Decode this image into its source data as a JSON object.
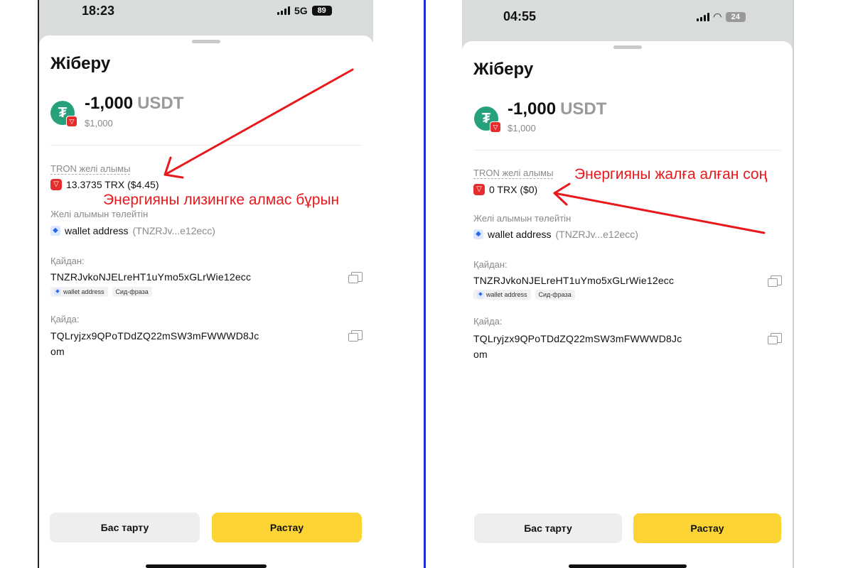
{
  "colors": {
    "accent": "#fcd535",
    "annotation": "#e8191d",
    "divider": "#1f2bd6",
    "usdt": "#26a17b",
    "tron": "#e52d2d"
  },
  "left": {
    "status": {
      "time": "18:23",
      "network": "5G",
      "battery": "89"
    },
    "title": "Жіберу",
    "amount": "-1,000",
    "unit": "USDT",
    "fiat": "$1,000",
    "fee_label": "TRON желі алымы",
    "fee_value": "13.3735 TRX ($4.45)",
    "payer_label": "Желі алымын төлейтін",
    "payer_name": "wallet address",
    "payer_short": "(TNZRJv...e12ecc)",
    "from_label": "Қайдан:",
    "from_address": "TNZRJvkoNJELreHT1uYmo5xGLrWie12ecc",
    "tag_wallet": "wallet address",
    "tag_seed": "Сид-фраза",
    "to_label": "Қайда:",
    "to_address_line1": "TQLryjzx9QPoTDdZQ22mSW3mFWWWD8Jc",
    "to_address_line2": "om",
    "cancel": "Бас тарту",
    "confirm": "Растау",
    "annotation": "Энергияны лизингке алмас бұрын"
  },
  "right": {
    "status": {
      "time": "04:55",
      "battery": "24"
    },
    "title": "Жіберу",
    "amount": "-1,000",
    "unit": "USDT",
    "fiat": "$1,000",
    "fee_label": "TRON желі алымы",
    "fee_value": "0 TRX ($0)",
    "payer_label": "Желі алымын төлейтін",
    "payer_name": "wallet address",
    "payer_short": "(TNZRJv...e12ecc)",
    "from_label": "Қайдан:",
    "from_address": "TNZRJvkoNJELreHT1uYmo5xGLrWie12ecc",
    "tag_wallet": "wallet address",
    "tag_seed": "Сид-фраза",
    "to_label": "Қайда:",
    "to_address_line1": "TQLryjzx9QPoTDdZQ22mSW3mFWWWD8Jc",
    "to_address_line2": "om",
    "cancel": "Бас тарту",
    "confirm": "Растау",
    "annotation": "Энергияны жалға алған соң"
  }
}
